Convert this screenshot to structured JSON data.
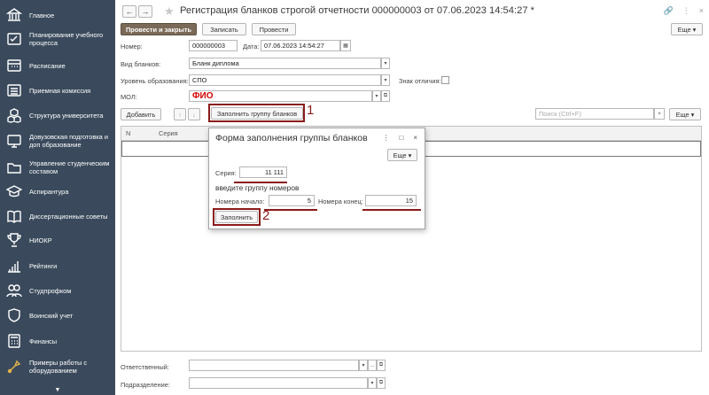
{
  "sidebar": {
    "items": [
      {
        "label": "Главное",
        "icon": "building-icon"
      },
      {
        "label": "Планирование учебного процесса",
        "icon": "checklist-icon"
      },
      {
        "label": "Расписание",
        "icon": "calendar-icon"
      },
      {
        "label": "Приемная комиссия",
        "icon": "list-icon"
      },
      {
        "label": "Структура университета",
        "icon": "structure-icon"
      },
      {
        "label": "Довузовская подготовка и доп образование",
        "icon": "monitor-icon"
      },
      {
        "label": "Управление студенческим составом",
        "icon": "folder-icon"
      },
      {
        "label": "Аспирантура",
        "icon": "graduation-cap-icon"
      },
      {
        "label": "Диссертационные советы",
        "icon": "book-icon"
      },
      {
        "label": "НИОКР",
        "icon": "trophy-icon"
      },
      {
        "label": "Рейтинги",
        "icon": "bar-chart-icon"
      },
      {
        "label": "Студпрофком",
        "icon": "people-icon"
      },
      {
        "label": "Воинский учет",
        "icon": "shield-icon"
      },
      {
        "label": "Финансы",
        "icon": "calculator-icon"
      },
      {
        "label": "Примеры работы с оборудованием",
        "icon": "tools-icon"
      }
    ],
    "more_icon": "chevron-down-icon"
  },
  "header": {
    "back": "←",
    "forward": "→",
    "star": "★",
    "title": "Регистрация бланков строгой отчетности 000000003 от 07.06.2023 14:54:27 *",
    "link_icon": "🔗",
    "menu_icon": "⋮",
    "close_icon": "×"
  },
  "toolbar": {
    "post_close": "Провести и закрыть",
    "save": "Записать",
    "post": "Провести",
    "more": "Еще ▾"
  },
  "form": {
    "number_label": "Номер:",
    "number_value": "000000003",
    "date_label": "Дата:",
    "date_value": "07.06.2023 14:54:27",
    "blank_type_label": "Вид бланков:",
    "blank_type_value": "Бланк диплома",
    "edu_level_label": "Уровень образования:",
    "edu_level_value": "СПО",
    "honors_label": "Знак отличия:",
    "mol_label": "МОЛ:",
    "mol_value": "ФИО"
  },
  "table_toolbar": {
    "add": "Добавить",
    "up": "↑",
    "down": "↓",
    "fill_group": "Заполнить группу бланков",
    "search_placeholder": "Поиск (Ctrl+F)",
    "clear": "×",
    "more": "Еще ▾"
  },
  "table": {
    "columns": [
      "N",
      "Серия"
    ]
  },
  "dialog": {
    "title": "Форма заполнения группы бланков",
    "menu_icon": "⋮",
    "maximize_icon": "□",
    "close_icon": "×",
    "more": "Еще ▾",
    "series_label": "Серия:",
    "series_value": "11 111",
    "hint": "введите группу номеров",
    "start_label": "Номера начало:",
    "start_value": "5",
    "end_label": "Номера конец:",
    "end_value": "15",
    "fill_button": "Заполнить"
  },
  "annotations": {
    "mark1": "1",
    "mark2": "2"
  },
  "footer": {
    "responsible_label": "Ответственный:",
    "responsible_value": "",
    "department_label": "Подразделение:",
    "department_value": ""
  },
  "colors": {
    "sidebar_bg": "#3a4a5c",
    "primary_button": "#7b6a57",
    "annotation": "#8b1a1a",
    "mol_text": "#d40000"
  }
}
